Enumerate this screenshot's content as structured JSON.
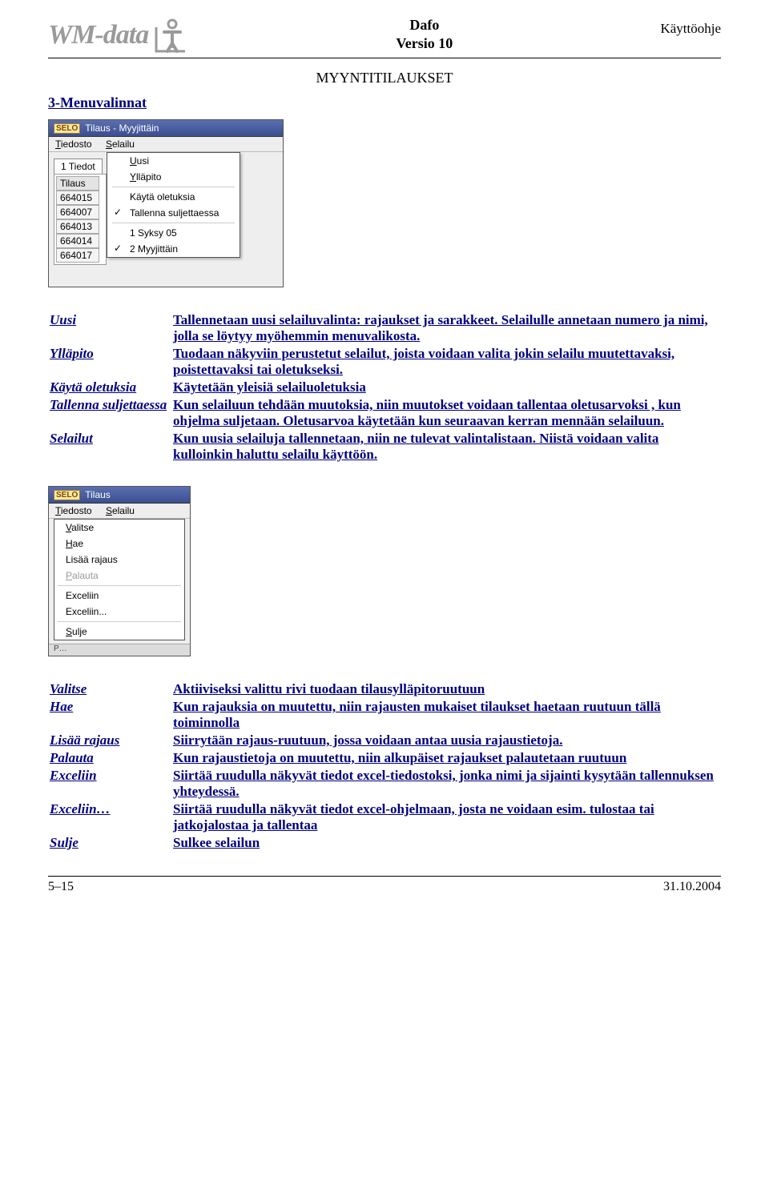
{
  "header": {
    "logo_text": "WM-data",
    "title_line1": "Dafo",
    "title_line2": "Versio 10",
    "right": "Käyttöohje",
    "sub": "MYYNTITILAUKSET"
  },
  "heading": "3-Menuvalinnat",
  "shot1": {
    "badge": "SELO",
    "title": "Tilaus - Myyjittäin",
    "menubar": {
      "file_u": "T",
      "file_rest": "iedosto",
      "view_u": "S",
      "view_rest": "elailu"
    },
    "tab": "1 Tiedot",
    "grid_head": "Tilaus",
    "rows": [
      "664015",
      "664007",
      "664013",
      "664014",
      "664017"
    ],
    "popup": {
      "uusi_u": "U",
      "uusi_rest": "usi",
      "yll_u": "Y",
      "yll_rest": "lläpito",
      "oletuksia": "Käytä oletuksia",
      "tallenna": "Tallenna suljettaessa",
      "rec1": "1 Syksy 05",
      "rec2": "2 Myyjittäin"
    }
  },
  "defs1": [
    {
      "term": "Uusi",
      "desc": "Tallennetaan uusi selailuvalinta: rajaukset ja sarakkeet. Selailulle annetaan numero ja nimi, jolla se löytyy myöhemmin menuvalikosta."
    },
    {
      "term": "Ylläpito",
      "desc": "Tuodaan näkyviin perustetut selailut, joista voidaan valita jokin selailu muutettavaksi, poistettavaksi tai oletukseksi."
    },
    {
      "term": "Käytä oletuksia",
      "desc": "Käytetään yleisiä selailuoletuksia"
    },
    {
      "term": "Tallenna suljettaessa",
      "desc": "Kun selailuun tehdään muutoksia, niin muutokset voidaan tallentaa oletusarvoksi , kun ohjelma suljetaan. Oletusarvoa käytetään kun seuraavan kerran mennään selailuun."
    },
    {
      "term": "Selailut",
      "desc": "Kun uusia selailuja tallennetaan, niin ne tulevat valintalistaan. Niistä voidaan valita kulloinkin haluttu selailu käyttöön."
    }
  ],
  "shot2": {
    "badge": "SELO",
    "title": "Tilaus",
    "menubar": {
      "file_u": "T",
      "file_rest": "iedosto",
      "view_u": "S",
      "view_rest": "elailu"
    },
    "items": {
      "valitse_u": "V",
      "valitse_rest": "alitse",
      "hae_u": "H",
      "hae_rest": "ae",
      "lisaa": "Lisää rajaus",
      "palauta_u": "P",
      "palauta_rest": "alauta",
      "exceliin": "Exceliin",
      "exceliin2": "Exceliin...",
      "sulje_u": "S",
      "sulje_rest": "ulje"
    },
    "stripe_label": "P…"
  },
  "defs2": [
    {
      "term": "Valitse",
      "desc": "Aktiiviseksi valittu rivi tuodaan tilausylläpitoruutuun"
    },
    {
      "term": "Hae",
      "desc": "Kun rajauksia on muutettu, niin rajausten mukaiset tilaukset haetaan ruutuun tällä toiminnolla"
    },
    {
      "term": "Lisää rajaus",
      "desc": "Siirrytään rajaus-ruutuun, jossa voidaan antaa uusia rajaustietoja."
    },
    {
      "term": "Palauta",
      "desc": "Kun rajaustietoja on muutettu, niin alkupäiset rajaukset palautetaan ruutuun"
    },
    {
      "term": "Exceliin",
      "desc": "Siirtää ruudulla näkyvät tiedot excel-tiedostoksi, jonka nimi ja sijainti kysytään tallennuksen yhteydessä."
    },
    {
      "term": "Exceliin…",
      "desc": "Siirtää ruudulla näkyvät tiedot excel-ohjelmaan, josta ne voidaan esim. tulostaa tai jatkojalostaa ja tallentaa"
    },
    {
      "term": "Sulje",
      "desc": "Sulkee selailun"
    }
  ],
  "footer": {
    "left": "5–15",
    "right": "31.10.2004"
  }
}
